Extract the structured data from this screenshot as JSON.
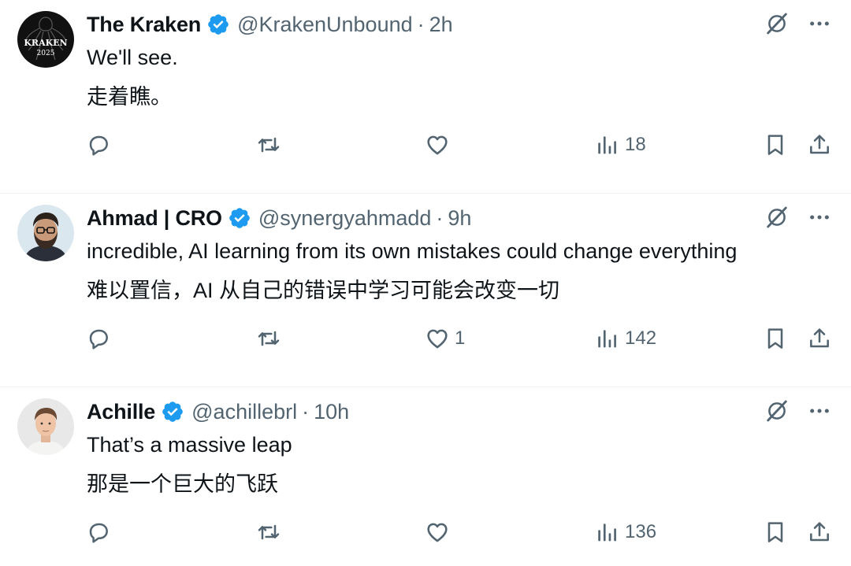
{
  "tweets": [
    {
      "author": "The Kraken",
      "handle": "@KrakenUnbound",
      "separator": "·",
      "time": "2h",
      "avatar": {
        "line1": "KRAKEN",
        "line2": "2025",
        "bg": "#111111"
      },
      "text_en": "We'll see.",
      "text_zh": "走着瞧。",
      "likes": "",
      "views": "18"
    },
    {
      "author": "Ahmad | CRO",
      "handle": "@synergyahmadd",
      "separator": "·",
      "time": "9h",
      "avatar": {
        "bg": "#dbe7ef"
      },
      "text_en": "incredible, AI learning from its own mistakes could change everything",
      "text_zh": "难以置信，AI 从自己的错误中学习可能会改变一切",
      "likes": "1",
      "views": "142"
    },
    {
      "author": "Achille",
      "handle": "@achillebrl",
      "separator": "·",
      "time": "10h",
      "avatar": {
        "bg": "#e8e8e8"
      },
      "text_en": "That’s a massive leap",
      "text_zh": "那是一个巨大的飞跃",
      "likes": "",
      "views": "136"
    }
  ],
  "icons": {
    "verified": "verified-badge-icon",
    "grok": "grok-icon",
    "more": "more-icon",
    "reply": "reply-icon",
    "retweet": "retweet-icon",
    "like": "like-icon",
    "views": "views-icon",
    "bookmark": "bookmark-icon",
    "share": "share-icon"
  },
  "colors": {
    "text": "#0f1419",
    "secondary": "#536471",
    "verified": "#1d9bf0",
    "divider": "#eff3f4"
  }
}
